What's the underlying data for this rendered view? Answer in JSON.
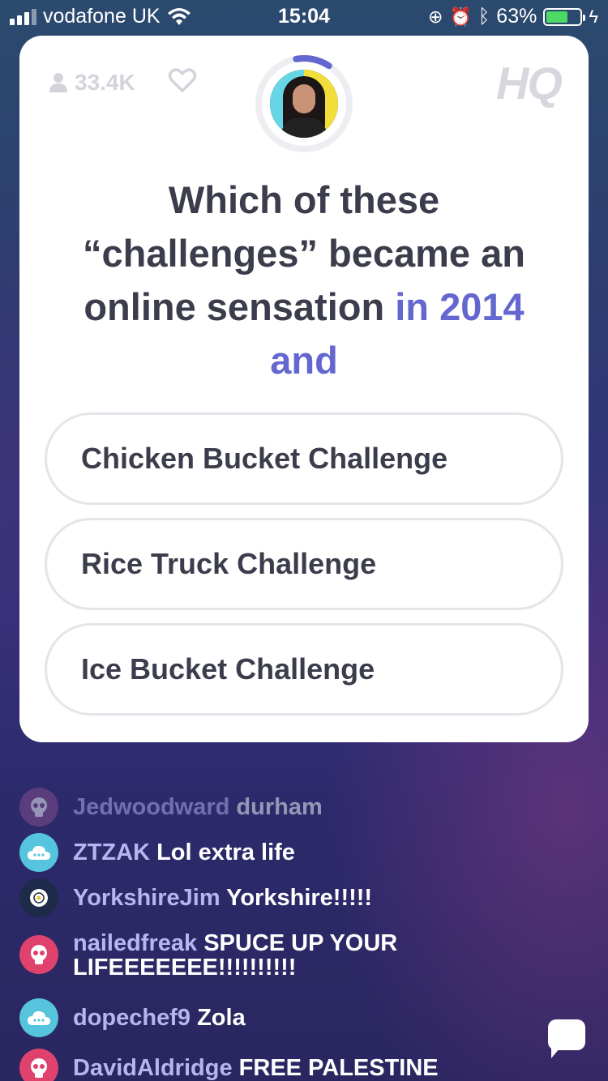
{
  "status_bar": {
    "carrier": "vodafone UK",
    "time": "15:04",
    "battery_percent": "63%",
    "battery_level": 0.63,
    "icons": [
      "signal-icon",
      "wifi-icon",
      "orientation-lock-icon",
      "alarm-icon",
      "bluetooth-icon",
      "battery-icon",
      "charging-icon"
    ]
  },
  "game": {
    "viewer_count": "33.4K",
    "logo": "HQ",
    "timer_progress": 0.12,
    "question_main": "Which of these “challenges” became an online sensation",
    "question_highlight": "in 2014 and",
    "answers": [
      "Chicken Bucket Challenge",
      "Rice Truck Challenge",
      "Ice Bucket Challenge"
    ]
  },
  "chat": [
    {
      "user": "Jedwoodward",
      "message": "durham",
      "avatar_color": "#8a4f8f",
      "avatar_icon": "skull-icon"
    },
    {
      "user": "ZTZAK",
      "message": "Lol extra life",
      "avatar_color": "#55c4dc",
      "avatar_icon": "cloud-icon"
    },
    {
      "user": "YorkshireJim",
      "message": "Yorkshire!!!!!",
      "avatar_color": "#1d2a4a",
      "avatar_icon": "rose-icon"
    },
    {
      "user": "nailedfreak",
      "message": "SPUCE UP YOUR LIFEEEEEEE!!!!!!!!!!",
      "avatar_color": "#e0426e",
      "avatar_icon": "skull-icon"
    },
    {
      "user": "dopechef9",
      "message": "Zola",
      "avatar_color": "#55c4dc",
      "avatar_icon": "cloud-icon"
    },
    {
      "user": "DavidAldridge",
      "message": "FREE PALESTINE",
      "avatar_color": "#e0426e",
      "avatar_icon": "skull-icon"
    }
  ],
  "colors": {
    "accent": "#6467cf",
    "question_text": "#3c3d4c",
    "chat_username": "#b8b4f0"
  }
}
